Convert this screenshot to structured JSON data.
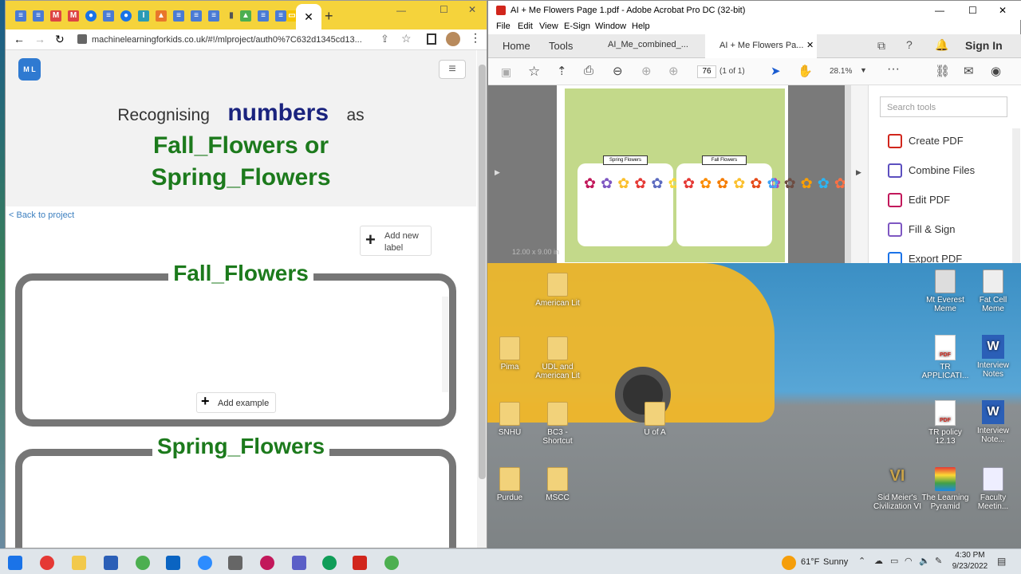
{
  "chrome": {
    "url": "machinelearningforkids.co.uk/#!/mlproject/auth0%7C632d1345cd13...",
    "page_heading_prefix": "Recognising",
    "page_heading_type": "numbers",
    "page_heading_as": "as",
    "page_heading_labels": "Fall_Flowers or Spring_Flowers",
    "back_link": "< Back to project",
    "add_label_button": "Add new label",
    "label_1": "Fall_Flowers",
    "label_2": "Spring_Flowers",
    "add_example_button": "Add example",
    "colors": {
      "accent_green": "#1c7a1c",
      "heading_navy": "#1a237e",
      "tab_bar": "#f5d33b"
    }
  },
  "acrobat": {
    "window_title": "AI + Me Flowers Page 1.pdf - Adobe Acrobat Pro DC (32-bit)",
    "menu": [
      "File",
      "Edit",
      "View",
      "E-Sign",
      "Window",
      "Help"
    ],
    "tabs": [
      "Home",
      "Tools",
      "AI_Me_combined_...",
      "AI + Me Flowers Pa..."
    ],
    "sign_in": "Sign In",
    "page_number": "76",
    "page_of": "(1 of 1)",
    "zoom": "28.1%",
    "page_size": "12.00 x 9.00 in",
    "search_placeholder": "Search tools",
    "tools": [
      "Create PDF",
      "Combine Files",
      "Edit PDF",
      "Fill & Sign",
      "Export PDF"
    ],
    "doc_labels": {
      "spring": "Spring Flowers",
      "fall": "Fall Flowers"
    }
  },
  "desktop": {
    "icons": [
      {
        "label": "American Lit",
        "type": "folder"
      },
      {
        "label": "Pima",
        "type": "folder"
      },
      {
        "label": "UDL and American Lit",
        "type": "folder"
      },
      {
        "label": "SNHU",
        "type": "folder"
      },
      {
        "label": "BC3 - Shortcut",
        "type": "folder"
      },
      {
        "label": "U of A",
        "type": "folder"
      },
      {
        "label": "Purdue",
        "type": "folder"
      },
      {
        "label": "MSCC",
        "type": "folder"
      },
      {
        "label": "Mt Everest Meme",
        "type": "image"
      },
      {
        "label": "Fat Cell Meme",
        "type": "image"
      },
      {
        "label": "TR APPLICATI...",
        "type": "pdf"
      },
      {
        "label": "Interview Notes",
        "type": "word"
      },
      {
        "label": "TR policy 12.13",
        "type": "pdf"
      },
      {
        "label": "Interview Note...",
        "type": "word"
      },
      {
        "label": "Sid Meier's Civilization VI",
        "type": "app"
      },
      {
        "label": "The Learning Pyramid",
        "type": "image"
      },
      {
        "label": "Faculty Meetin...",
        "type": "image"
      }
    ]
  },
  "taskbar": {
    "weather_temp": "61°F",
    "weather_text": "Sunny",
    "time": "4:30 PM",
    "date": "9/23/2022"
  }
}
